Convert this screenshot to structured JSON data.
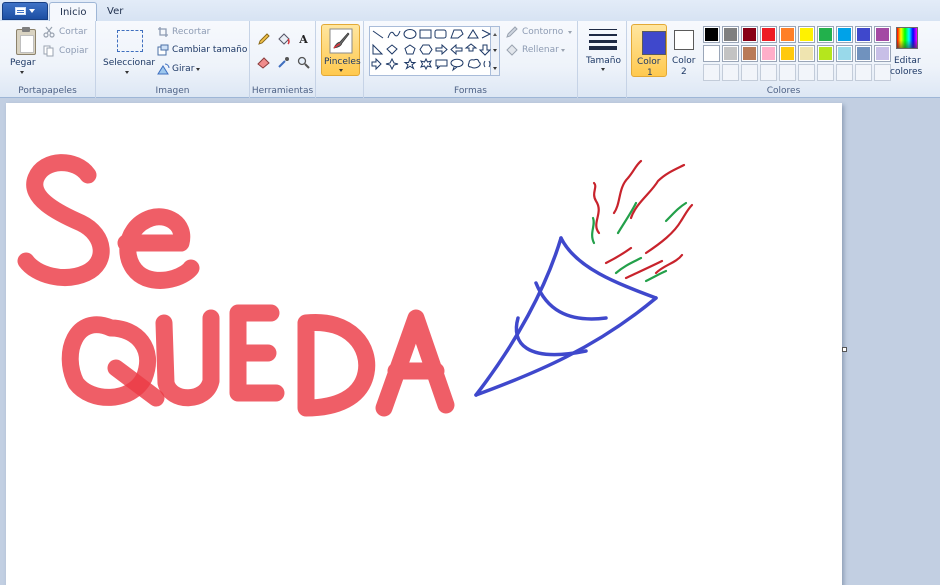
{
  "tabs": {
    "inicio": "Inicio",
    "ver": "Ver"
  },
  "clipboard": {
    "paste": "Pegar",
    "cut": "Cortar",
    "copy": "Copiar",
    "group": "Portapapeles"
  },
  "image": {
    "select": "Seleccionar",
    "crop": "Recortar",
    "resize": "Cambiar tamaño",
    "rotate": "Girar",
    "group": "Imagen"
  },
  "tools": {
    "group": "Herramientas"
  },
  "brushes": {
    "label": "Pinceles"
  },
  "shapes": {
    "outline": "Contorno",
    "fill": "Rellenar",
    "group": "Formas"
  },
  "size": {
    "label": "Tamaño"
  },
  "colors": {
    "color1_line1": "Color",
    "color1_line2": "1",
    "color2_line1": "Color",
    "color2_line2": "2",
    "edit_line1": "Editar",
    "edit_line2": "colores",
    "group": "Colores",
    "color1_value": "#3f48cc",
    "color2_value": "#ffffff",
    "palette_row1": [
      "#000000",
      "#7f7f7f",
      "#880015",
      "#ed1c24",
      "#ff7f27",
      "#fff200",
      "#22b14c",
      "#00a2e8",
      "#3f48cc",
      "#a349a4"
    ],
    "palette_row2": [
      "#ffffff",
      "#c3c3c3",
      "#b97a57",
      "#ffaec9",
      "#ffc90e",
      "#efe4b0",
      "#b5e61d",
      "#99d9ea",
      "#7092be",
      "#c8bfe7"
    ]
  }
}
